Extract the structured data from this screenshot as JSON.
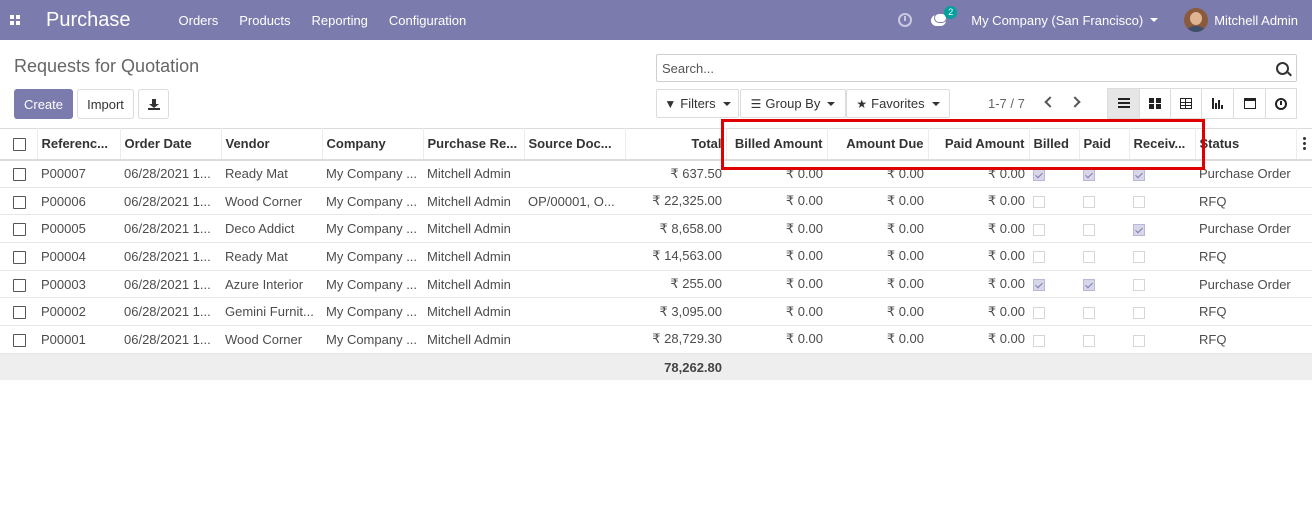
{
  "navbar": {
    "brand": "Purchase",
    "menu": [
      "Orders",
      "Products",
      "Reporting",
      "Configuration"
    ],
    "chat_badge": "2",
    "company": "My Company (San Francisco)",
    "user": "Mitchell Admin",
    "color": "#7c7bad"
  },
  "page": {
    "title": "Requests for Quotation",
    "create_label": "Create",
    "import_label": "Import"
  },
  "search": {
    "placeholder": "Search..."
  },
  "filters": {
    "filters_label": "Filters",
    "group_by_label": "Group By",
    "favorites_label": "Favorites"
  },
  "pager": {
    "value": "1-7 / 7"
  },
  "table": {
    "headers": {
      "reference": "Referenc...",
      "order_date": "Order Date",
      "vendor": "Vendor",
      "company": "Company",
      "purchase_rep": "Purchase Re...",
      "source_doc": "Source Doc...",
      "total": "Total",
      "billed_amount": "Billed Amount",
      "amount_due": "Amount Due",
      "paid_amount": "Paid Amount",
      "billed": "Billed",
      "paid": "Paid",
      "received": "Receiv...",
      "status": "Status"
    },
    "rows": [
      {
        "ref": "P00007",
        "date": "06/28/2021 1...",
        "vendor": "Ready Mat",
        "company": "My Company ...",
        "rep": "Mitchell Admin",
        "source": "",
        "total": "₹ 637.50",
        "billed_amount": "₹ 0.00",
        "due": "₹ 0.00",
        "paid_amount": "₹ 0.00",
        "billed": true,
        "paid": true,
        "received": true,
        "status": "Purchase Order"
      },
      {
        "ref": "P00006",
        "date": "06/28/2021 1...",
        "vendor": "Wood Corner",
        "company": "My Company ...",
        "rep": "Mitchell Admin",
        "source": "OP/00001, O...",
        "total": "₹ 22,325.00",
        "billed_amount": "₹ 0.00",
        "due": "₹ 0.00",
        "paid_amount": "₹ 0.00",
        "billed": false,
        "paid": false,
        "received": false,
        "status": "RFQ"
      },
      {
        "ref": "P00005",
        "date": "06/28/2021 1...",
        "vendor": "Deco Addict",
        "company": "My Company ...",
        "rep": "Mitchell Admin",
        "source": "",
        "total": "₹ 8,658.00",
        "billed_amount": "₹ 0.00",
        "due": "₹ 0.00",
        "paid_amount": "₹ 0.00",
        "billed": false,
        "paid": false,
        "received": true,
        "status": "Purchase Order"
      },
      {
        "ref": "P00004",
        "date": "06/28/2021 1...",
        "vendor": "Ready Mat",
        "company": "My Company ...",
        "rep": "Mitchell Admin",
        "source": "",
        "total": "₹ 14,563.00",
        "billed_amount": "₹ 0.00",
        "due": "₹ 0.00",
        "paid_amount": "₹ 0.00",
        "billed": false,
        "paid": false,
        "received": false,
        "status": "RFQ"
      },
      {
        "ref": "P00003",
        "date": "06/28/2021 1...",
        "vendor": "Azure Interior",
        "company": "My Company ...",
        "rep": "Mitchell Admin",
        "source": "",
        "total": "₹ 255.00",
        "billed_amount": "₹ 0.00",
        "due": "₹ 0.00",
        "paid_amount": "₹ 0.00",
        "billed": true,
        "paid": true,
        "received": false,
        "status": "Purchase Order"
      },
      {
        "ref": "P00002",
        "date": "06/28/2021 1...",
        "vendor": "Gemini Furnit...",
        "company": "My Company ...",
        "rep": "Mitchell Admin",
        "source": "",
        "total": "₹ 3,095.00",
        "billed_amount": "₹ 0.00",
        "due": "₹ 0.00",
        "paid_amount": "₹ 0.00",
        "billed": false,
        "paid": false,
        "received": false,
        "status": "RFQ"
      },
      {
        "ref": "P00001",
        "date": "06/28/2021 1...",
        "vendor": "Wood Corner",
        "company": "My Company ...",
        "rep": "Mitchell Admin",
        "source": "",
        "total": "₹ 28,729.30",
        "billed_amount": "₹ 0.00",
        "due": "₹ 0.00",
        "paid_amount": "₹ 0.00",
        "billed": false,
        "paid": false,
        "received": false,
        "status": "RFQ"
      }
    ],
    "footer_total": "78,262.80"
  }
}
